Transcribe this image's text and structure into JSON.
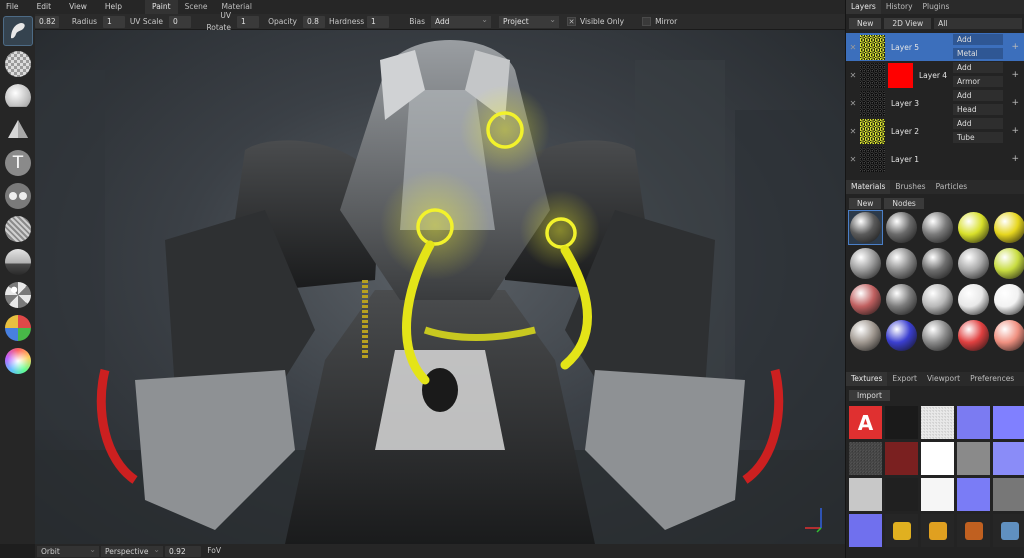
{
  "menu": [
    "File",
    "Edit",
    "View",
    "Help"
  ],
  "workspaces": [
    {
      "label": "Paint",
      "active": true
    },
    {
      "label": "Scene",
      "active": false
    },
    {
      "label": "Material",
      "active": false
    }
  ],
  "toolbar": {
    "radius_value": "0.82",
    "radius_label": "Radius",
    "uvscale_value": "1",
    "uvscale_label": "UV Scale",
    "uvrotate_value": "0",
    "uvrotate_label": "UV Rotate",
    "opacity_value": "1",
    "opacity_label": "Opacity",
    "hardness_value": "0.8",
    "hardness_label": "Hardness",
    "bias_value": "1",
    "bias_label": "Bias",
    "blend_mode": "Add",
    "projection": "Project",
    "visible_only_label": "Visible Only",
    "visible_only_mark": "✕",
    "mirror_label": "Mirror"
  },
  "tools": [
    {
      "name": "brush",
      "icon": "brush-icon",
      "active": true
    },
    {
      "name": "eraser",
      "icon": "eraser-checker-icon",
      "active": false
    },
    {
      "name": "fill",
      "icon": "fill-hemisphere-icon",
      "active": false
    },
    {
      "name": "decal",
      "icon": "cone-decal-icon",
      "active": false
    },
    {
      "name": "text",
      "icon": "text-icon",
      "glyph": "T",
      "active": false
    },
    {
      "name": "clone",
      "icon": "clone-circles-icon",
      "active": false
    },
    {
      "name": "blur",
      "icon": "blur-striped-ball-icon",
      "active": false
    },
    {
      "name": "particle",
      "icon": "particle-ball-icon",
      "active": false
    },
    {
      "name": "colorid",
      "icon": "colorid-patches-ball-icon",
      "active": false
    },
    {
      "name": "picker",
      "icon": "color-picker-ball-icon",
      "active": false
    },
    {
      "name": "gradient",
      "icon": "gradient-ball-icon",
      "active": false
    }
  ],
  "status": {
    "nav_mode": "Orbit",
    "camera_type": "Perspective",
    "fov_value": "0.92",
    "fov_label": "FoV"
  },
  "layers_panel": {
    "tabs": [
      {
        "label": "Layers",
        "active": true
      },
      {
        "label": "History",
        "active": false
      },
      {
        "label": "Plugins",
        "active": false
      }
    ],
    "new_label": "New",
    "view_label": "2D View",
    "filter_value": "All",
    "close_glyph": "✕",
    "add_glyph": "+",
    "layers": [
      {
        "name": "Layer 5",
        "blend": "Add",
        "material": "Metal",
        "selected": true,
        "thumb": "yellow-noise",
        "mask": false
      },
      {
        "name": "Layer 4",
        "blend": "Add",
        "material": "Armor",
        "selected": false,
        "thumb": "gray-noise",
        "mask": true,
        "mask_color": "#ff0000"
      },
      {
        "name": "Layer 3",
        "blend": "Add",
        "material": "Head",
        "selected": false,
        "thumb": "gray-noise",
        "mask": false
      },
      {
        "name": "Layer 2",
        "blend": "Add",
        "material": "Tube",
        "selected": false,
        "thumb": "yellow-noise",
        "mask": false
      },
      {
        "name": "Layer 1",
        "blend": "",
        "material": "",
        "selected": false,
        "thumb": "gray-noise",
        "mask": false
      }
    ]
  },
  "materials_panel": {
    "tabs": [
      {
        "label": "Materials",
        "active": true
      },
      {
        "label": "Brushes",
        "active": false
      },
      {
        "label": "Particles",
        "active": false
      }
    ],
    "new_label": "New",
    "nodes_label": "Nodes",
    "materials": [
      {
        "color": "#5a5a5a",
        "selected": true
      },
      {
        "color": "#6a6a6a"
      },
      {
        "color": "#7a7a7a"
      },
      {
        "color": "#d8e02a"
      },
      {
        "color": "#e6d61e"
      },
      {
        "color": "#9a9a9a"
      },
      {
        "color": "#8c8c8c"
      },
      {
        "color": "#6e6e6e"
      },
      {
        "color": "#a8a8a8"
      },
      {
        "color": "#c8dc40"
      },
      {
        "color": "#c06060"
      },
      {
        "color": "#7c7c7c"
      },
      {
        "color": "#b8b8b8"
      },
      {
        "color": "#e8e8e8"
      },
      {
        "color": "#f2f2f2"
      },
      {
        "color": "#a09890"
      },
      {
        "color": "#3b3fd0"
      },
      {
        "color": "#8a8a8a"
      },
      {
        "color": "#e04040"
      },
      {
        "color": "#f09080"
      }
    ]
  },
  "textures_panel": {
    "tabs": [
      {
        "label": "Textures",
        "active": true
      },
      {
        "label": "Export",
        "active": false
      },
      {
        "label": "Viewport",
        "active": false
      },
      {
        "label": "Preferences",
        "active": false
      }
    ],
    "import_label": "Import",
    "logo_letter": "A",
    "textures": [
      {
        "kind": "logo",
        "color": "#e03030"
      },
      {
        "kind": "dark",
        "color": "#1a1a1a"
      },
      {
        "kind": "noise",
        "color": "#e8e8e8"
      },
      {
        "kind": "normal",
        "color": "#7b7bf2"
      },
      {
        "kind": "normal",
        "color": "#8080ff"
      },
      {
        "kind": "grunge",
        "color": "#3a3a3a"
      },
      {
        "kind": "red",
        "color": "#7a2020"
      },
      {
        "kind": "white",
        "color": "#ffffff"
      },
      {
        "kind": "gray",
        "color": "#8a8a8a"
      },
      {
        "kind": "normal",
        "color": "#8a8cf8"
      },
      {
        "kind": "light",
        "color": "#c8c8c8"
      },
      {
        "kind": "dark",
        "color": "#202020"
      },
      {
        "kind": "white",
        "color": "#f6f6f6"
      },
      {
        "kind": "normal",
        "color": "#7a7cf6"
      },
      {
        "kind": "gray",
        "color": "#777777"
      },
      {
        "kind": "normal",
        "color": "#7070ee"
      },
      {
        "kind": "icon",
        "color": "#e0b020"
      },
      {
        "kind": "icon",
        "color": "#e0a020"
      },
      {
        "kind": "icon",
        "color": "#c06020"
      },
      {
        "kind": "icon",
        "color": "#6090c0"
      }
    ]
  },
  "colors": {
    "selection": "#3c6fbc",
    "accent_yellow": "#f2f22c"
  }
}
